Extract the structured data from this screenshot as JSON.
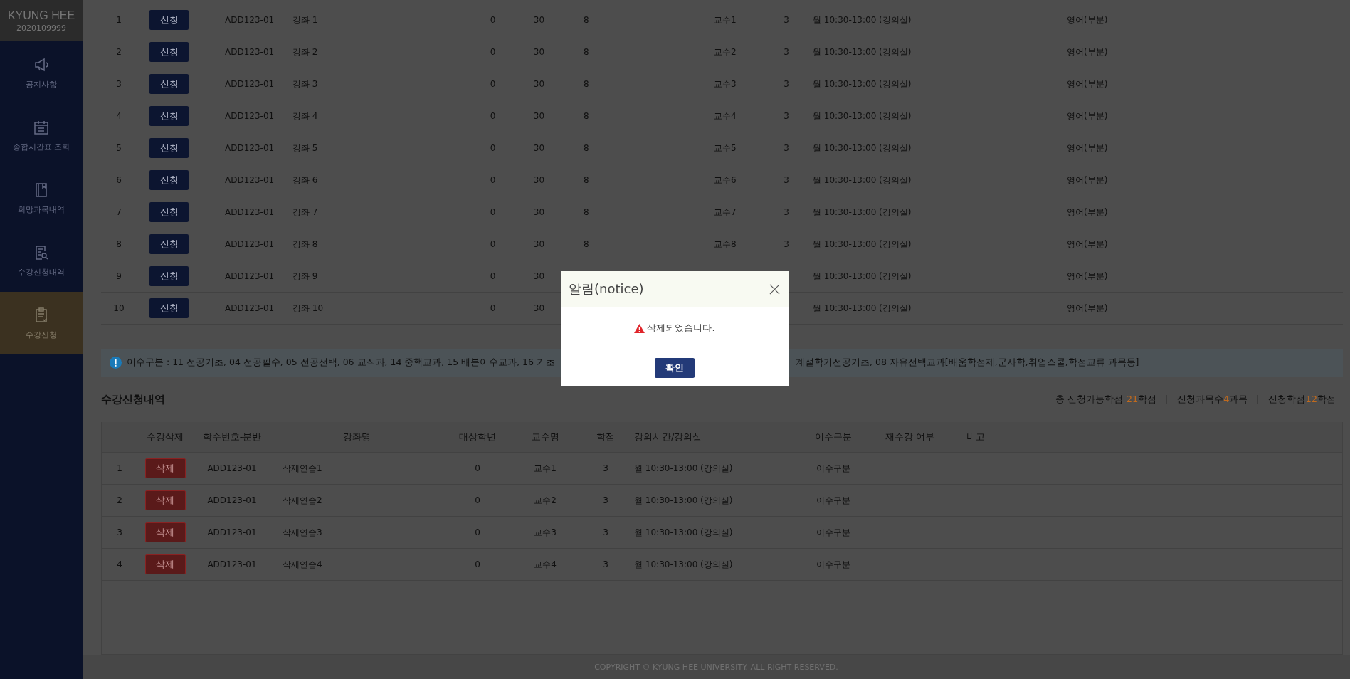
{
  "sidebar": {
    "brand": "KYUNG HEE",
    "student_id": "2020109999",
    "items": [
      {
        "label": "공지사항",
        "selected": false
      },
      {
        "label": "종합시간표 조회",
        "selected": false
      },
      {
        "label": "희망과목내역",
        "selected": false
      },
      {
        "label": "수강신청내역",
        "selected": false
      },
      {
        "label": "수강신청",
        "selected": true
      }
    ]
  },
  "course_table": {
    "rows": [
      {
        "no": "1",
        "action": "신청",
        "code": "ADD123-01",
        "name": "강좌 1",
        "column_5": "0",
        "column_6": "30",
        "column_7": "8",
        "professor": "교수1",
        "credit": "3",
        "time": "월 10:30-13:00 (강의실)",
        "language": "영어(부분)"
      },
      {
        "no": "2",
        "action": "신청",
        "code": "ADD123-01",
        "name": "강좌 2",
        "column_5": "0",
        "column_6": "30",
        "column_7": "8",
        "professor": "교수2",
        "credit": "3",
        "time": "월 10:30-13:00 (강의실)",
        "language": "영어(부분)"
      },
      {
        "no": "3",
        "action": "신청",
        "code": "ADD123-01",
        "name": "강좌 3",
        "column_5": "0",
        "column_6": "30",
        "column_7": "8",
        "professor": "교수3",
        "credit": "3",
        "time": "월 10:30-13:00 (강의실)",
        "language": "영어(부분)"
      },
      {
        "no": "4",
        "action": "신청",
        "code": "ADD123-01",
        "name": "강좌 4",
        "column_5": "0",
        "column_6": "30",
        "column_7": "8",
        "professor": "교수4",
        "credit": "3",
        "time": "월 10:30-13:00 (강의실)",
        "language": "영어(부분)"
      },
      {
        "no": "5",
        "action": "신청",
        "code": "ADD123-01",
        "name": "강좌 5",
        "column_5": "0",
        "column_6": "30",
        "column_7": "8",
        "professor": "교수5",
        "credit": "3",
        "time": "월 10:30-13:00 (강의실)",
        "language": "영어(부분)"
      },
      {
        "no": "6",
        "action": "신청",
        "code": "ADD123-01",
        "name": "강좌 6",
        "column_5": "0",
        "column_6": "30",
        "column_7": "8",
        "professor": "교수6",
        "credit": "3",
        "time": "월 10:30-13:00 (강의실)",
        "language": "영어(부분)"
      },
      {
        "no": "7",
        "action": "신청",
        "code": "ADD123-01",
        "name": "강좌 7",
        "column_5": "0",
        "column_6": "30",
        "column_7": "8",
        "professor": "교수7",
        "credit": "3",
        "time": "월 10:30-13:00 (강의실)",
        "language": "영어(부분)"
      },
      {
        "no": "8",
        "action": "신청",
        "code": "ADD123-01",
        "name": "강좌 8",
        "column_5": "0",
        "column_6": "30",
        "column_7": "8",
        "professor": "교수8",
        "credit": "3",
        "time": "월 10:30-13:00 (강의실)",
        "language": "영어(부분)"
      },
      {
        "no": "9",
        "action": "신청",
        "code": "ADD123-01",
        "name": "강좌 9",
        "column_5": "0",
        "column_6": "30",
        "time": "월 10:30-13:00 (강의실)",
        "language": "영어(부분)"
      },
      {
        "no": "10",
        "action": "신청",
        "code": "ADD123-01",
        "name": "강좌 10",
        "column_5": "0",
        "column_6": "30",
        "time": "월 10:30-13:00 (강의실)",
        "language": "영어(부분)"
      }
    ]
  },
  "info_note": {
    "text_before": "이수구분 : 11 전공기초, 04 전공필수, 05 전공선택, 06 교직과, 14 중핵교과, 15 배분이수교과, 16 기초",
    "text_after": "계절학기전공기초, 08 자유선택교과[배움학점제,군사학,취업스쿨,학점교류 과목등]"
  },
  "registered": {
    "title": "수강신청내역",
    "summary": [
      {
        "label": "총 신청가능학점 ",
        "value": "21",
        "unit": "학점"
      },
      {
        "label": "신청과목수",
        "value": "4",
        "unit": "과목"
      },
      {
        "label": "신청학점",
        "value": "12",
        "unit": "학점"
      }
    ],
    "columns": [
      "수강삭제",
      "학수번호-분반",
      "강좌명",
      "대상학년",
      "교수명",
      "학점",
      "강의시간/강의실",
      "이수구분",
      "재수강 여부",
      "비고"
    ],
    "rows": [
      {
        "no": "1",
        "action": "삭제",
        "code": "ADD123-01",
        "name": "삭제연습1",
        "grade": "0",
        "professor": "교수1",
        "credit": "3",
        "time": "월 10:30-13:00 (강의실)",
        "category": "이수구분"
      },
      {
        "no": "2",
        "action": "삭제",
        "code": "ADD123-01",
        "name": "삭제연습2",
        "grade": "0",
        "professor": "교수2",
        "credit": "3",
        "time": "월 10:30-13:00 (강의실)",
        "category": "이수구분"
      },
      {
        "no": "3",
        "action": "삭제",
        "code": "ADD123-01",
        "name": "삭제연습3",
        "grade": "0",
        "professor": "교수3",
        "credit": "3",
        "time": "월 10:30-13:00 (강의실)",
        "category": "이수구분"
      },
      {
        "no": "4",
        "action": "삭제",
        "code": "ADD123-01",
        "name": "삭제연습4",
        "grade": "0",
        "professor": "교수4",
        "credit": "3",
        "time": "월 10:30-13:00 (강의실)",
        "category": "이수구분"
      }
    ]
  },
  "footer": "COPYRIGHT © KYUNG HEE UNIVERSITY. ALL RIGHT RESERVED.",
  "dialog": {
    "title": "알림(notice)",
    "message": "삭제되었습니다.",
    "button": "확인"
  }
}
